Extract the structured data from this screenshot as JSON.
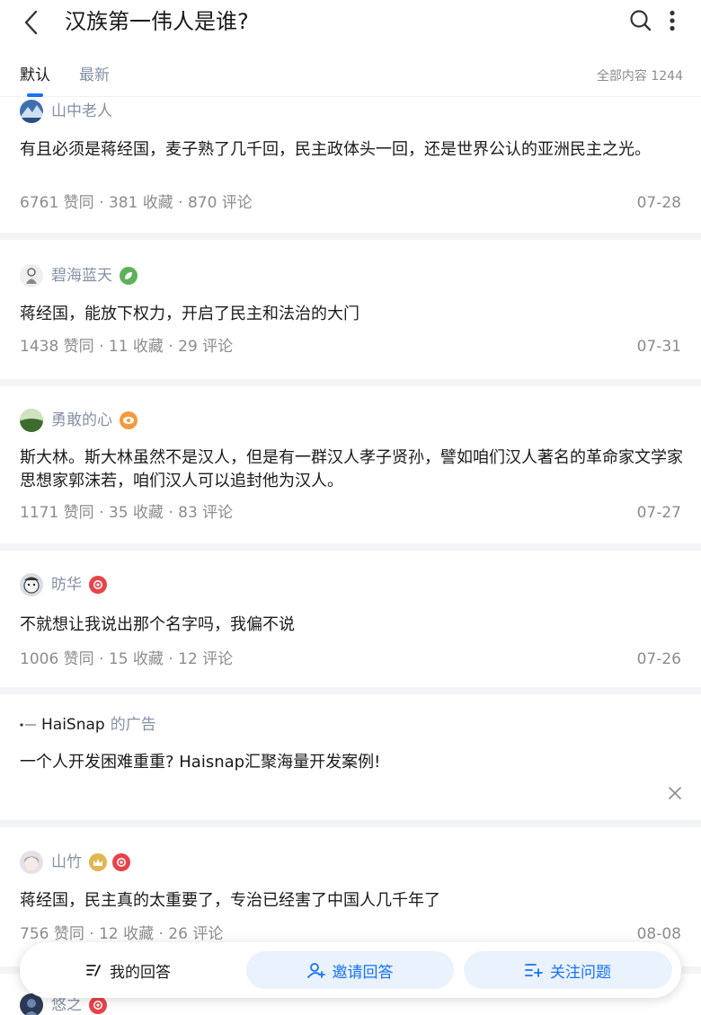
{
  "header": {
    "title": "汉族第一伟人是谁?"
  },
  "tabs": {
    "items": [
      {
        "label": "默认",
        "active": true
      },
      {
        "label": "最新",
        "active": false
      }
    ],
    "total_label": "全部内容 1244"
  },
  "answers": [
    {
      "author": "山中老人",
      "avatar_icon": "mountain-avatar",
      "badges": [],
      "text": "有且必须是蒋经国，麦子熟了几千回，民主政体头一回，还是世界公认的亚洲民主之光。",
      "stats": "6761 赞同 · 381 收藏 · 870 评论",
      "date": "07-28"
    },
    {
      "author": "碧海蓝天",
      "avatar_icon": "sketch-avatar",
      "badges": [
        "green-leaf-badge"
      ],
      "text": "蒋经国，能放下权力，开启了民主和法治的大门",
      "stats": "1438 赞同 · 11 收藏 · 29 评论",
      "date": "07-31"
    },
    {
      "author": "勇敢的心",
      "avatar_icon": "landscape-avatar",
      "badges": [
        "orange-eye-badge"
      ],
      "text": "斯大林。斯大林虽然不是汉人，但是有一群汉人孝子贤孙，譬如咱们汉人著名的革命家文学家思想家郭沫若，咱们汉人可以追封他为汉人。",
      "stats": "1171 赞同 · 35 收藏 · 83 评论",
      "date": "07-27"
    },
    {
      "author": "昉华",
      "avatar_icon": "cartoon-face-avatar",
      "badges": [
        "red-medal-badge"
      ],
      "text": "不就想让我说出那个名字吗，我偏不说",
      "stats": "1006 赞同 · 15 收藏 · 12 评论",
      "date": "07-26"
    },
    {
      "author": "山竹",
      "avatar_icon": "anime-avatar",
      "badges": [
        "gold-crown-badge",
        "red-medal-badge"
      ],
      "text": "蒋经国，民主真的太重要了，专治已经害了中国人几千年了",
      "stats": "756 赞同 · 12 收藏 · 26 评论",
      "date": "08-08"
    },
    {
      "author": "悠之",
      "avatar_icon": "dark-avatar",
      "badges": [
        "red-medal-badge"
      ]
    }
  ],
  "ad": {
    "brand": "HaiSnap",
    "suffix": "的广告",
    "text": "一个人开发困难重重? Haisnap汇聚海量开发案例!"
  },
  "actions": {
    "mine": "我的回答",
    "invite": "邀请回答",
    "follow": "关注问题"
  },
  "colors": {
    "accent": "#1772f6",
    "accent_bg": "#eaf2fd",
    "meta_text": "#8c8c8c",
    "author_text": "#8590a6",
    "separator": "#f3f4f6"
  }
}
